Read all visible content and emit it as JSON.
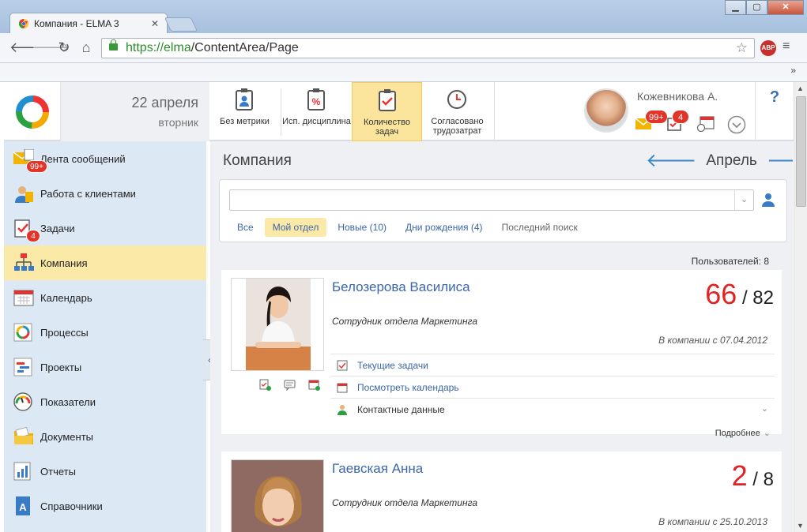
{
  "browser": {
    "tab_title": "Компания - ELMA 3",
    "url_scheme": "https://",
    "url_host": "elma",
    "url_path": "/ContentArea/Page",
    "buttons": {
      "minimize": "▁",
      "maximize": "▢",
      "close": "✕"
    }
  },
  "header": {
    "date": "22 апреля",
    "weekday": "вторник",
    "metrics": [
      {
        "label": "Без метрики",
        "icon": "clipboard-person-icon"
      },
      {
        "label": "Исп. дисциплина",
        "icon": "clipboard-percent-icon"
      },
      {
        "label": "Количество задач",
        "icon": "clipboard-check-icon",
        "active": true
      },
      {
        "label": "Согласовано трудозатрат",
        "icon": "clock-icon"
      }
    ],
    "user": {
      "name": "Кожевникова А.",
      "messages_badge": "99+",
      "tasks_badge": "4"
    },
    "help": "?"
  },
  "sidebar": {
    "items": [
      {
        "label": "Лента сообщений",
        "badge": "99+",
        "icon": "envelope-icon"
      },
      {
        "label": "Работа с клиентами",
        "icon": "client-icon"
      },
      {
        "label": "Задачи",
        "badge": "4",
        "icon": "tasks-icon"
      },
      {
        "label": "Компания",
        "active": true,
        "icon": "org-chart-icon"
      },
      {
        "label": "Календарь",
        "icon": "calendar-icon"
      },
      {
        "label": "Процессы",
        "icon": "process-icon"
      },
      {
        "label": "Проекты",
        "icon": "projects-icon"
      },
      {
        "label": "Показатели",
        "icon": "gauge-icon"
      },
      {
        "label": "Документы",
        "icon": "folder-icon"
      },
      {
        "label": "Отчеты",
        "icon": "report-icon"
      },
      {
        "label": "Справочники",
        "icon": "reference-book-icon"
      }
    ]
  },
  "main": {
    "title": "Компания",
    "month": "Апрель",
    "filters": [
      "Все",
      "Мой отдел",
      "Новые (10)",
      "Дни рождения (4)",
      "Последний поиск"
    ],
    "selected_filter": "Мой отдел",
    "users_count": "Пользователей: 8",
    "employees": [
      {
        "name": "Белозерова Василиса",
        "position": "Сотрудник отдела Маркетинга",
        "since": "В компании с 07.04.2012",
        "score_main": "66",
        "score_sep": " / ",
        "score_total": "82",
        "links": [
          "Текущие задачи",
          "Посмотреть календарь",
          "Контактные данные"
        ],
        "more": "Подробнее"
      },
      {
        "name": "Гаевская Анна",
        "position": "Сотрудник отдела Маркетинга",
        "since": "В компании с 25.10.2013",
        "score_main": "2",
        "score_sep": " / ",
        "score_total": "8"
      }
    ]
  },
  "colors": {
    "accent_blue": "#3b66a8",
    "highlight_yellow": "#fbe9a8",
    "badge_red": "#e1352a",
    "score_red": "#e02222",
    "sidebar_bg": "#dde8f5"
  }
}
